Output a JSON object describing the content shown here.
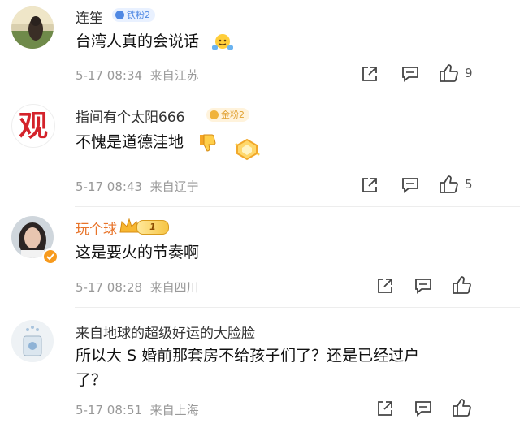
{
  "comments": [
    {
      "user": "连笙",
      "badge": "铁粉2",
      "text": "台湾人真的会说话",
      "time": "5-17 08:34",
      "location": "来自江苏",
      "likes": "9"
    },
    {
      "user": "指间有个太阳666",
      "badge": "金粉2",
      "text": "不愧是道德洼地",
      "time": "5-17 08:43",
      "location": "来自辽宁",
      "likes": "5",
      "avatar_char": "观"
    },
    {
      "user": "玩个球",
      "badge": "1",
      "text": "这是要火的节奏啊",
      "time": "5-17 08:28",
      "location": "来自四川",
      "likes": ""
    },
    {
      "user": "来自地球的超级好运的大脸脸",
      "text_line1": "所以大 S 婚前那套房不给孩子们了？还是已经过户",
      "text_line2": "了？",
      "time": "5-17 08:51",
      "location": "来自上海",
      "likes": ""
    }
  ],
  "colors": {
    "iron_badge_bg": "#e9f1ff",
    "iron_badge_fg": "#4f88e3",
    "gold_badge_bg": "#fff3dc",
    "gold_badge_fg": "#e0a030",
    "orange_name": "#e8742a",
    "meta_gray": "#999999"
  },
  "icons": {
    "forward": "share-square-icon",
    "comment": "comment-bubble-icon",
    "like": "thumbs-up-icon"
  }
}
